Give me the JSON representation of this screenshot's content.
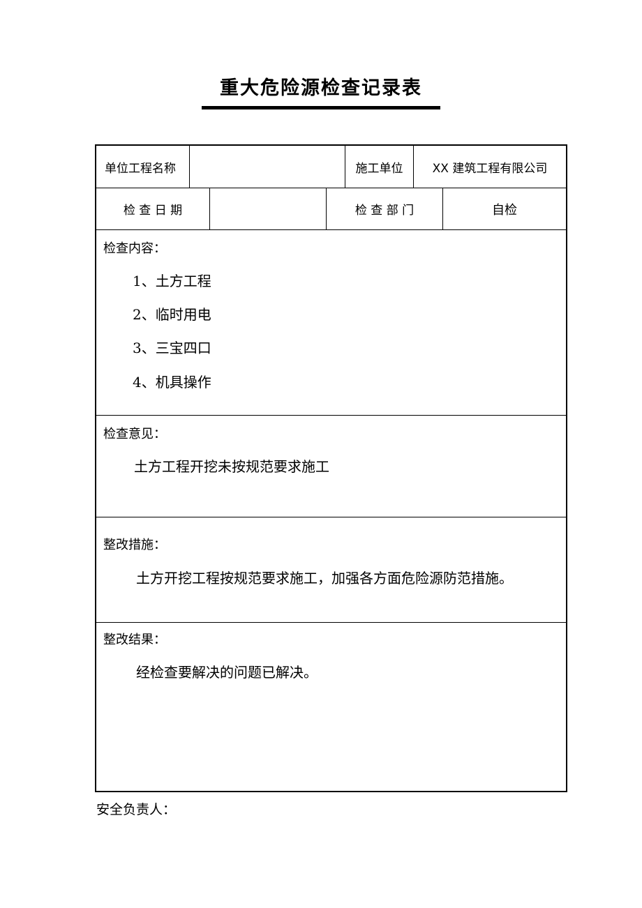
{
  "document": {
    "title": "重大危险源检查记录表",
    "header_row_1": {
      "project_name_label": "单位工程名称",
      "project_name_value": "",
      "contractor_label": "施工单位",
      "contractor_value": "XX 建筑工程有限公司"
    },
    "header_row_2": {
      "date_label": "检 查 日 期",
      "date_value": "",
      "department_label": "检 查 部 门",
      "department_value": "自检"
    },
    "inspection_content": {
      "heading": "检查内容：",
      "items": [
        "1、土方工程",
        "2、临时用电",
        "3、三宝四口",
        "4、机具操作"
      ]
    },
    "inspection_opinion": {
      "heading": "检查意见：",
      "text": "土方工程开挖未按规范要求施工"
    },
    "rectification_measures": {
      "heading": "整改措施：",
      "text": "土方开挖工程按规范要求施工，加强各方面危险源防范措施。"
    },
    "rectification_result": {
      "heading": "整改结果：",
      "text": "经检查要解决的问题已解决。"
    },
    "footer": {
      "safety_officer_label": "安全负责人："
    }
  }
}
